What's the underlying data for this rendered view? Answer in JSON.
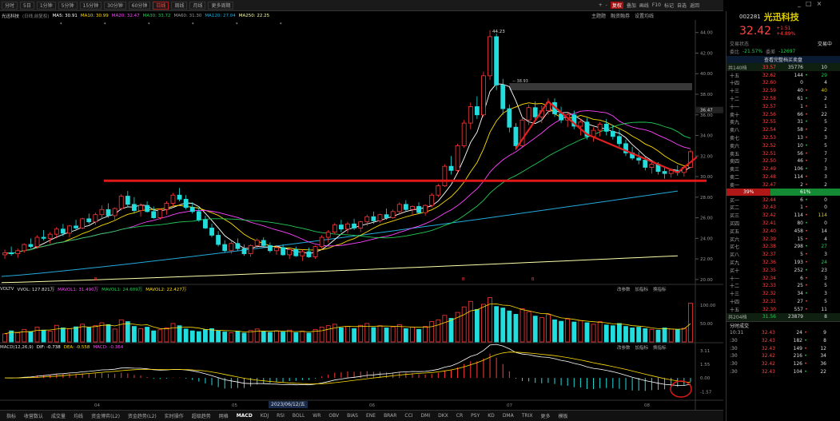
{
  "toolbar": {
    "left": [
      "分时",
      "5日",
      "1分钟",
      "5分钟",
      "15分钟",
      "30分钟",
      "60分钟",
      "日线",
      "周线",
      "月线",
      "更多周期"
    ],
    "left_active": "日线",
    "right": [
      "+",
      "-",
      "复权",
      "叠加",
      "画线",
      "F10",
      "标记",
      "自选",
      "返回"
    ],
    "right_active": "复权"
  },
  "window_controls": [
    "_",
    "□",
    "×"
  ],
  "infobar": {
    "name": "光迅科技",
    "mode": "(日线,前复权)",
    "ma_labels": [
      {
        "text": "MA5: 30.91",
        "color": "#ffffff"
      },
      {
        "text": "MA10: 30.99",
        "color": "#ffdd00"
      },
      {
        "text": "MA20: 32.47",
        "color": "#ff44ff"
      },
      {
        "text": "MA30: 33.72",
        "color": "#22cc55"
      },
      {
        "text": "MA60: 31.30",
        "color": "#999999"
      },
      {
        "text": "MA120: 27.04",
        "color": "#22aadd"
      },
      {
        "text": "MA250: 22.25",
        "color": "#ffffaa"
      }
    ],
    "markers": "* * * * * *"
  },
  "stage_buttons": [
    "主题题",
    "融资融券",
    "设置均线"
  ],
  "compare_label": "买热题",
  "chart_data": {
    "type": "candlestick",
    "ylim": [
      19.6,
      44.6
    ],
    "y_ticks": [
      44.0,
      42.0,
      40.0,
      38.0,
      36.0,
      34.0,
      32.0,
      30.0,
      28.0,
      26.0,
      24.0,
      22.0,
      20.0
    ],
    "current_price_label": "36.47",
    "x_ticks": [
      "04",
      "05",
      "06",
      "07",
      "08"
    ],
    "annotations": [
      {
        "text": "44.23"
      },
      {
        "text": "-- 38.93"
      }
    ],
    "candles": [
      [
        22.4,
        22.9,
        22.0,
        22.6
      ],
      [
        22.6,
        23.2,
        22.3,
        22.5
      ],
      [
        22.5,
        23.0,
        22.1,
        22.8
      ],
      [
        22.8,
        23.5,
        22.6,
        23.4
      ],
      [
        23.4,
        24.0,
        23.0,
        23.2
      ],
      [
        23.2,
        24.3,
        23.0,
        24.1
      ],
      [
        24.1,
        24.8,
        23.8,
        24.0
      ],
      [
        24.0,
        24.6,
        23.5,
        24.4
      ],
      [
        24.4,
        25.1,
        24.0,
        24.9
      ],
      [
        24.9,
        25.4,
        24.2,
        24.5
      ],
      [
        24.5,
        25.3,
        24.1,
        25.2
      ],
      [
        25.2,
        25.8,
        24.8,
        25.0
      ],
      [
        25.0,
        26.0,
        24.9,
        25.9
      ],
      [
        25.9,
        26.4,
        25.4,
        25.6
      ],
      [
        25.6,
        26.5,
        25.3,
        26.3
      ],
      [
        26.3,
        27.2,
        25.9,
        26.8
      ],
      [
        26.8,
        27.4,
        26.0,
        26.2
      ],
      [
        26.2,
        27.0,
        25.8,
        26.9
      ],
      [
        26.9,
        28.3,
        26.7,
        28.1
      ],
      [
        28.1,
        28.6,
        27.0,
        27.3
      ],
      [
        27.3,
        28.0,
        26.4,
        26.7
      ],
      [
        26.7,
        27.4,
        26.1,
        27.2
      ],
      [
        27.2,
        27.6,
        26.5,
        26.6
      ],
      [
        26.6,
        27.1,
        25.9,
        26.0
      ],
      [
        26.0,
        26.9,
        25.8,
        26.8
      ],
      [
        26.8,
        27.6,
        26.3,
        27.4
      ],
      [
        27.4,
        28.4,
        27.1,
        28.2
      ],
      [
        28.2,
        28.9,
        27.6,
        27.8
      ],
      [
        27.8,
        28.2,
        26.8,
        27.0
      ],
      [
        27.0,
        27.5,
        26.4,
        26.6
      ],
      [
        26.6,
        27.0,
        25.6,
        25.8
      ],
      [
        25.8,
        26.2,
        24.9,
        25.0
      ],
      [
        25.0,
        25.4,
        24.1,
        24.3
      ],
      [
        24.3,
        24.7,
        23.2,
        23.4
      ],
      [
        23.4,
        23.8,
        22.6,
        22.8
      ],
      [
        22.8,
        23.7,
        22.5,
        23.5
      ],
      [
        23.5,
        24.0,
        22.8,
        23.0
      ],
      [
        23.0,
        23.4,
        22.3,
        22.5
      ],
      [
        22.5,
        23.4,
        22.2,
        23.3
      ],
      [
        23.3,
        24.0,
        23.0,
        23.8
      ],
      [
        23.8,
        24.1,
        23.1,
        23.3
      ],
      [
        23.3,
        23.6,
        22.6,
        22.8
      ],
      [
        22.8,
        23.2,
        22.4,
        23.1
      ],
      [
        23.1,
        23.4,
        22.3,
        22.4
      ],
      [
        22.4,
        23.0,
        22.0,
        22.9
      ],
      [
        22.9,
        23.2,
        22.2,
        22.3
      ],
      [
        22.3,
        22.9,
        21.8,
        22.7
      ],
      [
        22.7,
        23.1,
        22.1,
        22.2
      ],
      [
        22.2,
        23.3,
        22.0,
        23.2
      ],
      [
        23.2,
        24.3,
        23.0,
        24.1
      ],
      [
        24.1,
        24.8,
        23.6,
        24.6
      ],
      [
        24.6,
        25.5,
        24.4,
        25.3
      ],
      [
        25.3,
        25.8,
        24.6,
        24.9
      ],
      [
        24.9,
        25.6,
        24.5,
        25.4
      ],
      [
        25.4,
        25.9,
        24.8,
        25.0
      ],
      [
        25.0,
        25.7,
        24.6,
        25.6
      ],
      [
        25.6,
        26.3,
        25.2,
        26.1
      ],
      [
        26.1,
        26.6,
        25.4,
        25.7
      ],
      [
        25.7,
        26.4,
        25.5,
        26.3
      ],
      [
        26.3,
        26.9,
        25.8,
        26.0
      ],
      [
        26.0,
        26.8,
        25.9,
        26.6
      ],
      [
        26.6,
        27.5,
        26.3,
        27.3
      ],
      [
        27.3,
        27.7,
        26.6,
        26.8
      ],
      [
        26.8,
        27.2,
        26.2,
        27.1
      ],
      [
        27.1,
        27.5,
        26.4,
        26.5
      ],
      [
        26.5,
        27.3,
        26.2,
        27.2
      ],
      [
        27.2,
        28.4,
        27.0,
        28.2
      ],
      [
        28.2,
        29.3,
        28.0,
        29.1
      ],
      [
        29.1,
        31.2,
        29.0,
        31.0
      ],
      [
        31.0,
        32.0,
        30.2,
        30.6
      ],
      [
        30.6,
        33.2,
        30.4,
        33.0
      ],
      [
        33.0,
        35.5,
        32.8,
        35.2
      ],
      [
        35.2,
        37.2,
        34.6,
        36.8
      ],
      [
        36.8,
        37.8,
        35.6,
        36.0
      ],
      [
        36.0,
        40.2,
        35.8,
        39.8
      ],
      [
        39.8,
        44.23,
        39.4,
        43.6
      ],
      [
        43.6,
        43.9,
        38.4,
        38.9
      ],
      [
        38.9,
        39.5,
        36.0,
        36.6
      ],
      [
        36.6,
        37.0,
        34.3,
        34.8
      ],
      [
        34.8,
        35.2,
        32.6,
        33.0
      ],
      [
        33.0,
        35.8,
        32.8,
        35.5
      ],
      [
        35.5,
        37.0,
        35.0,
        36.7
      ],
      [
        36.7,
        37.3,
        35.5,
        35.8
      ],
      [
        35.8,
        36.9,
        35.2,
        36.4
      ],
      [
        36.4,
        37.6,
        36.0,
        37.2
      ],
      [
        37.2,
        37.6,
        35.8,
        36.1
      ],
      [
        36.1,
        36.8,
        35.2,
        35.5
      ],
      [
        35.5,
        36.3,
        34.8,
        36.0
      ],
      [
        36.0,
        36.4,
        34.6,
        34.9
      ],
      [
        34.9,
        35.6,
        34.0,
        35.3
      ],
      [
        35.3,
        35.7,
        33.6,
        33.9
      ],
      [
        33.9,
        34.8,
        33.4,
        34.5
      ],
      [
        34.5,
        35.3,
        33.9,
        35.1
      ],
      [
        35.1,
        35.6,
        34.0,
        34.4
      ],
      [
        34.4,
        35.0,
        33.6,
        33.9
      ],
      [
        33.9,
        34.6,
        32.9,
        33.2
      ],
      [
        33.2,
        33.6,
        32.0,
        32.3
      ],
      [
        32.3,
        32.9,
        31.6,
        31.8
      ],
      [
        31.8,
        32.4,
        31.2,
        31.6
      ],
      [
        31.6,
        32.0,
        30.6,
        30.9
      ],
      [
        30.9,
        31.5,
        30.3,
        31.2
      ],
      [
        31.2,
        31.4,
        30.2,
        30.5
      ],
      [
        30.5,
        31.0,
        29.8,
        30.3
      ],
      [
        30.3,
        30.8,
        29.9,
        30.6
      ],
      [
        30.6,
        31.1,
        30.1,
        30.4
      ],
      [
        30.4,
        31.0,
        30.0,
        30.9
      ],
      [
        30.9,
        32.6,
        30.8,
        32.42
      ]
    ],
    "ma_series": [
      {
        "name": "MA5",
        "color": "#ffffff",
        "period": 5
      },
      {
        "name": "MA10",
        "color": "#ffdd00",
        "period": 10
      },
      {
        "name": "MA20",
        "color": "#ff44ff",
        "period": 20
      },
      {
        "name": "MA30",
        "color": "#22cc55",
        "period": 30
      }
    ],
    "long_ma": [
      {
        "name": "MA120",
        "color": "#22aadd",
        "from": 20.3,
        "to": 28.6
      },
      {
        "name": "MA250",
        "color": "#ffffaa",
        "from": 19.7,
        "to": 22.3
      }
    ],
    "support_line": 29.6,
    "drawn_trend": [
      {
        "i": 79,
        "p": 32.7
      },
      {
        "i": 84,
        "p": 37.3
      },
      {
        "i": 90,
        "p": 34.1
      },
      {
        "i": 104,
        "p": 30.4
      },
      {
        "i": 107,
        "p": 31.9
      }
    ],
    "resistance_box": {
      "from": 78,
      "to": 120,
      "price": 38.7
    },
    "volume": {
      "ylim": [
        0,
        130
      ],
      "y_ticks": [
        "100.00",
        "50.00"
      ],
      "values": [
        22,
        30,
        25,
        34,
        28,
        40,
        32,
        29,
        45,
        38,
        36,
        41,
        48,
        39,
        44,
        52,
        47,
        35,
        60,
        55,
        42,
        36,
        40,
        30,
        33,
        38,
        50,
        44,
        35,
        30,
        28,
        33,
        36,
        30,
        27,
        25,
        29,
        24,
        31,
        35,
        28,
        26,
        30,
        27,
        32,
        25,
        29,
        24,
        34,
        40,
        44,
        48,
        38,
        42,
        36,
        45,
        50,
        39,
        44,
        38,
        41,
        47,
        36,
        40,
        34,
        42,
        55,
        60,
        72,
        64,
        80,
        95,
        110,
        88,
        102,
        120,
        96,
        92,
        84,
        75,
        90,
        82,
        70,
        66,
        74,
        60,
        56,
        62,
        54,
        58,
        52,
        48,
        55,
        46,
        44,
        50,
        42,
        38,
        40,
        36,
        34,
        32,
        38,
        35,
        33,
        37,
        105
      ],
      "ma_labels": [
        {
          "text": "VOLTV",
          "color": "#dddddd"
        },
        {
          "text": "VVOL: 127.821万",
          "color": "#dddddd"
        },
        {
          "text": "MAVOL1: 31.490万",
          "color": "#ff44ff"
        },
        {
          "text": "MAVOL1: 24.609万",
          "color": "#22cc55"
        },
        {
          "text": "MAVOL2: 22.427万",
          "color": "#ffdd00"
        }
      ]
    },
    "macd": {
      "ylim": [
        -2.0,
        3.2
      ],
      "y_ticks": [
        "3.11",
        "1.55",
        "0.00",
        "-1.57"
      ],
      "labels": [
        {
          "text": "MACD(12,26,9)",
          "color": "#dddddd"
        },
        {
          "text": "DIF: -0.738",
          "color": "#ffffff"
        },
        {
          "text": "DEA: -0.558",
          "color": "#ffdd00"
        },
        {
          "text": "MACD: -0.364",
          "color": "#ff44ff"
        }
      ]
    }
  },
  "sub_tools": [
    "改参数",
    "加指标",
    "换指标"
  ],
  "date_label": "2023/06/12/五",
  "bottom_tabs": [
    "指标",
    "收营数认",
    "成交量",
    "均线",
    "资金博弈(L2)",
    "资金趋势(L2)",
    "实时操作",
    "超级趋势",
    "网格",
    "MACD",
    "KDJ",
    "RSI",
    "BOLL",
    "WR",
    "OBV",
    "BIAS",
    "ENE",
    "BRAR",
    "CCI",
    "DMI",
    "DKX",
    "CR",
    "PSY",
    "KD",
    "DMA",
    "TRIX",
    "更多",
    "模板"
  ],
  "bottom_active": "MACD",
  "right_panel": {
    "code": "002281",
    "name": "光迅科技",
    "price": "32.42",
    "change": "+1.51",
    "change_pct": "+4.89%",
    "trade_status": "交易状态",
    "trade_status_r": "交易中",
    "ratio": {
      "label": "委比",
      "value": "-21.57%",
      "label2": "委差",
      "value2": "-12697"
    },
    "order_book_title": "查看完整档买卖盘",
    "sell_total": {
      "label": "共140档",
      "price": "33.57",
      "vol": "35776",
      "n": "10"
    },
    "sells": [
      {
        "l": "十五",
        "p": "32.62",
        "v": "144",
        "d": "•",
        "c": "29",
        "dc": "green"
      },
      {
        "l": "十四",
        "p": "32.60",
        "v": "0",
        "d": "",
        "c": "4",
        "dc": "white"
      },
      {
        "l": "十三",
        "p": "32.59",
        "v": "40",
        "d": "•",
        "c": "40",
        "dc": "yel"
      },
      {
        "l": "十二",
        "p": "32.58",
        "v": "61",
        "d": "•",
        "c": "2",
        "dc": "white"
      },
      {
        "l": "十一",
        "p": "32.57",
        "v": "1",
        "d": "•",
        "c": "1",
        "dc": "white"
      },
      {
        "l": "卖十",
        "p": "32.56",
        "v": "66",
        "d": "•",
        "c": "22",
        "dc": "white"
      },
      {
        "l": "卖九",
        "p": "32.55",
        "v": "31",
        "d": "•",
        "c": "5",
        "dc": "white"
      },
      {
        "l": "卖八",
        "p": "32.54",
        "v": "58",
        "d": "•",
        "c": "2",
        "dc": "white"
      },
      {
        "l": "卖七",
        "p": "32.53",
        "v": "13",
        "d": "•",
        "c": "3",
        "dc": "white"
      },
      {
        "l": "卖六",
        "p": "32.52",
        "v": "10",
        "d": "•",
        "c": "5",
        "dc": "white"
      },
      {
        "l": "卖五",
        "p": "32.51",
        "v": "56",
        "d": "•",
        "c": "7",
        "dc": "white"
      },
      {
        "l": "卖四",
        "p": "32.50",
        "v": "46",
        "d": "•",
        "c": "7",
        "dc": "white"
      },
      {
        "l": "卖三",
        "p": "32.49",
        "v": "106",
        "d": "•",
        "c": "3",
        "dc": "white"
      },
      {
        "l": "卖二",
        "p": "32.48",
        "v": "114",
        "d": "•",
        "c": "3",
        "dc": "white"
      },
      {
        "l": "卖一",
        "p": "32.47",
        "v": "2",
        "d": "•",
        "c": "2",
        "dc": "white"
      }
    ],
    "split": {
      "left": "39%",
      "right": "61%"
    },
    "buys": [
      {
        "l": "买一",
        "p": "32.44",
        "v": "6",
        "d": "•",
        "c": "0",
        "dc": "white"
      },
      {
        "l": "买二",
        "p": "32.43",
        "v": "1",
        "d": "•",
        "c": "0",
        "dc": "white"
      },
      {
        "l": "买三",
        "p": "32.42",
        "v": "114",
        "d": "•",
        "c": "114",
        "dc": "yel"
      },
      {
        "l": "买四",
        "p": "32.41",
        "v": "80",
        "d": "•",
        "c": "0",
        "dc": "white"
      },
      {
        "l": "买五",
        "p": "32.40",
        "v": "458",
        "d": "•",
        "c": "14",
        "dc": "white"
      },
      {
        "l": "买六",
        "p": "32.39",
        "v": "15",
        "d": "•",
        "c": "4",
        "dc": "white"
      },
      {
        "l": "买七",
        "p": "32.38",
        "v": "298",
        "d": "•",
        "c": "27",
        "dc": "green"
      },
      {
        "l": "买八",
        "p": "32.37",
        "v": "5",
        "d": "•",
        "c": "3",
        "dc": "white"
      },
      {
        "l": "买九",
        "p": "32.36",
        "v": "193",
        "d": "•",
        "c": "24",
        "dc": "green"
      },
      {
        "l": "买十",
        "p": "32.35",
        "v": "252",
        "d": "•",
        "c": "23",
        "dc": "white"
      },
      {
        "l": "十一",
        "p": "32.34",
        "v": "6",
        "d": "•",
        "c": "3",
        "dc": "white"
      },
      {
        "l": "十二",
        "p": "32.33",
        "v": "25",
        "d": "•",
        "c": "5",
        "dc": "white"
      },
      {
        "l": "十三",
        "p": "32.32",
        "v": "34",
        "d": "•",
        "c": "3",
        "dc": "white"
      },
      {
        "l": "十四",
        "p": "32.31",
        "v": "27",
        "d": "•",
        "c": "5",
        "dc": "white"
      },
      {
        "l": "十五",
        "p": "32.30",
        "v": "557",
        "d": "•",
        "c": "11",
        "dc": "white"
      }
    ],
    "buy_total": {
      "label": "共204档",
      "price": "31.56",
      "vol": "23879",
      "n": "8"
    },
    "ticks_title": "分时成交",
    "ticks": [
      {
        "t": "10:31",
        "p": "32.43",
        "v": "24",
        "d": "•",
        "c": "9"
      },
      {
        "t": ":30",
        "p": "32.43",
        "v": "182",
        "d": "•",
        "c": "8"
      },
      {
        "t": ":30",
        "p": "32.43",
        "v": "149",
        "d": "•",
        "c": "12"
      },
      {
        "t": ":30",
        "p": "32.42",
        "v": "216",
        "d": "•",
        "c": "34"
      },
      {
        "t": ":30",
        "p": "32.42",
        "v": "126",
        "d": "•",
        "c": "36"
      },
      {
        "t": ":30",
        "p": "32.43",
        "v": "104",
        "d": "•",
        "c": "22"
      }
    ]
  }
}
